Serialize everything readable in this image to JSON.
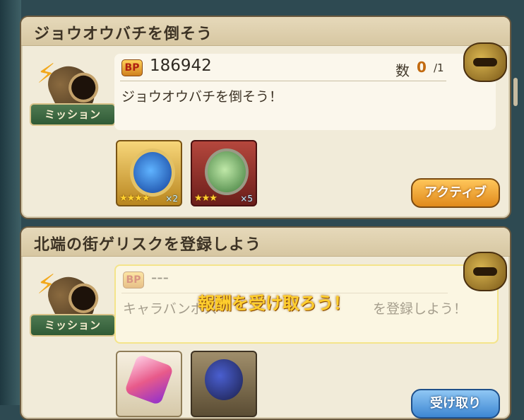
{
  "missions": [
    {
      "title": "ジョウオウバチを倒そう",
      "bp_label": "BP",
      "bp_value": "186942",
      "count_label": "数",
      "count_current": "0",
      "count_total": "/1",
      "description": "ジョウオウバチを倒そう！",
      "badge_label": "ミッション",
      "rewards": [
        {
          "stars": "★★★★",
          "qty": "×2"
        },
        {
          "stars": "★★★",
          "qty": "×5"
        }
      ],
      "button_label": "アクティブ"
    },
    {
      "title": "北端の街ゲリスクを登録しよう",
      "bp_label": "BP",
      "bp_value": "---",
      "description": "キャラバンポス",
      "description_tail": "を登録しよう！",
      "badge_label": "ミッション",
      "overlay_text": "報酬を受け取ろう！",
      "button_label": "受け取り"
    }
  ],
  "colors": {
    "accent": "#e08a1c",
    "receive": "#3d86d2"
  }
}
